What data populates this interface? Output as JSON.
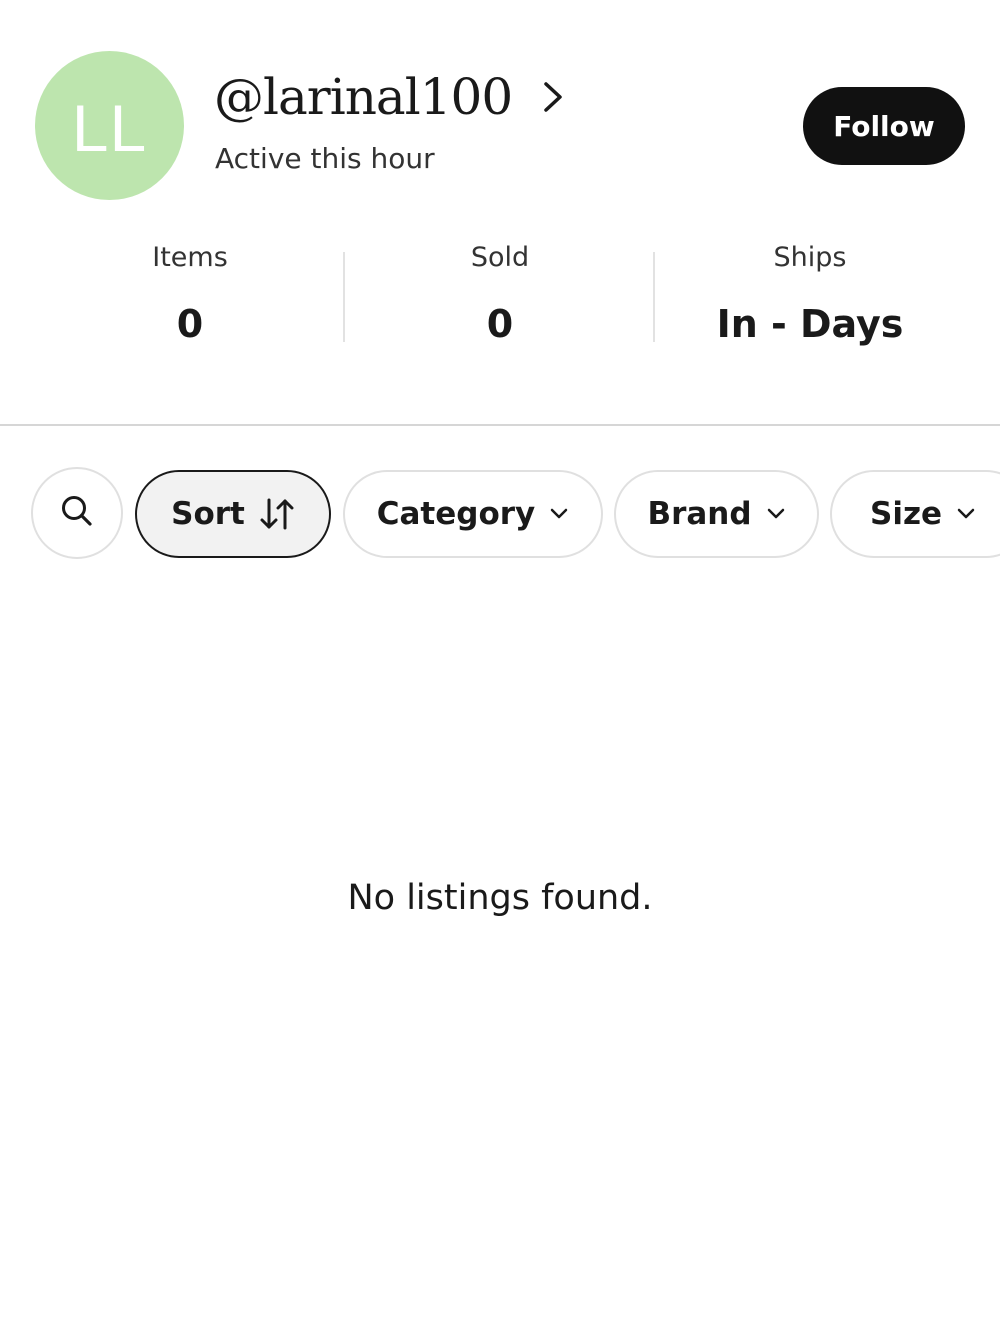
{
  "profile": {
    "avatar_initials": "LL",
    "avatar_color": "#bde5ae",
    "username": "@larinal100",
    "status": "Active this hour",
    "follow_label": "Follow"
  },
  "stats": [
    {
      "label": "Items",
      "value": "0"
    },
    {
      "label": "Sold",
      "value": "0"
    },
    {
      "label": "Ships",
      "value": "In - Days"
    }
  ],
  "filters": {
    "search_icon": "search-icon",
    "sort_label": "Sort",
    "sort_icon": "sort-arrows-icon",
    "category_label": "Category",
    "brand_label": "Brand",
    "size_label": "Size"
  },
  "empty_state": {
    "message": "No listings found."
  }
}
